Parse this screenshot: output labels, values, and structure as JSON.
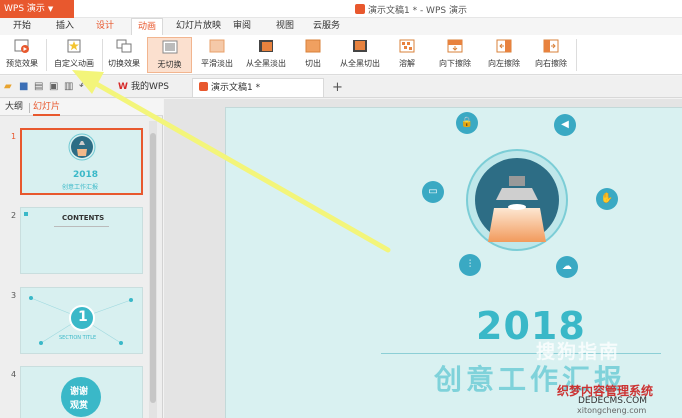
{
  "app": {
    "name": "WPS 演示",
    "window_title": "演示文稿1 * - WPS 演示"
  },
  "menu": {
    "tabs": [
      "开始",
      "插入",
      "设计",
      "动画",
      "幻灯片放映",
      "审阅",
      "视图",
      "云服务"
    ],
    "active": "动画"
  },
  "ribbon": {
    "preview": "预览效果",
    "custom_animation": "自定义动画",
    "switch_effect": "切换效果",
    "transitions": [
      "无切换",
      "平滑淡出",
      "从全黑淡出",
      "切出",
      "从全黑切出",
      "溶解",
      "向下擦除",
      "向左擦除",
      "向右擦除"
    ]
  },
  "doc_tabs": {
    "my_wps": "我的WPS",
    "current": "演示文稿1 *"
  },
  "left_panel": {
    "outline_tab": "大纲",
    "slides_tab": "幻灯片",
    "slide_numbers": [
      "1",
      "2",
      "3",
      "4"
    ]
  },
  "thumbs": {
    "t1_year": "2018",
    "t1_sub": "创意工作汇报",
    "t2_title": "CONTENTS",
    "t3_num": "1",
    "t3_title": "SECTION TITLE",
    "t4_text1": "谢谢",
    "t4_text2": "观赏"
  },
  "slide": {
    "year": "2018",
    "subtitle": "创意工作汇报"
  },
  "watermarks": {
    "sogou": "搜狗指南",
    "site_cn": "织梦内容管理系统",
    "site_en": "DEDECMS.COM",
    "site3": "xitongcheng.com"
  },
  "colors": {
    "accent": "#e8582e",
    "teal": "#3ab8c8",
    "slide_bg": "#d9f1f1",
    "arrow": "#f3f57a"
  }
}
